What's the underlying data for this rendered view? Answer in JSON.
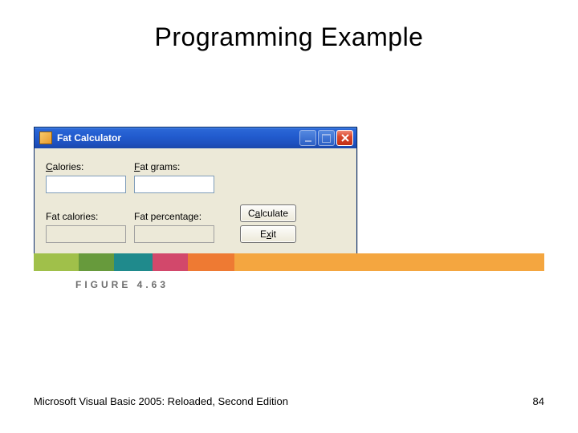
{
  "slide": {
    "title": "Programming Example",
    "figure_label": "FIGURE 4.63",
    "footer_text": "Microsoft Visual Basic 2005: Reloaded, Second Edition",
    "page_number": "84"
  },
  "window": {
    "title": "Fat Calculator",
    "icon_name": "app-icon",
    "fields": {
      "calories_label_pre": "",
      "calories_label_ul": "C",
      "calories_label_post": "alories:",
      "calories_value": "",
      "fatgrams_label_pre": "",
      "fatgrams_label_ul": "F",
      "fatgrams_label_post": "at grams:",
      "fatgrams_value": "",
      "fatcalories_label": "Fat calories:",
      "fatcalories_value": "",
      "fatpercent_label": "Fat percentage:",
      "fatpercent_value": ""
    },
    "buttons": {
      "calculate_pre": "C",
      "calculate_ul": "a",
      "calculate_post": "lculate",
      "exit_pre": "E",
      "exit_ul": "x",
      "exit_post": "it"
    }
  }
}
